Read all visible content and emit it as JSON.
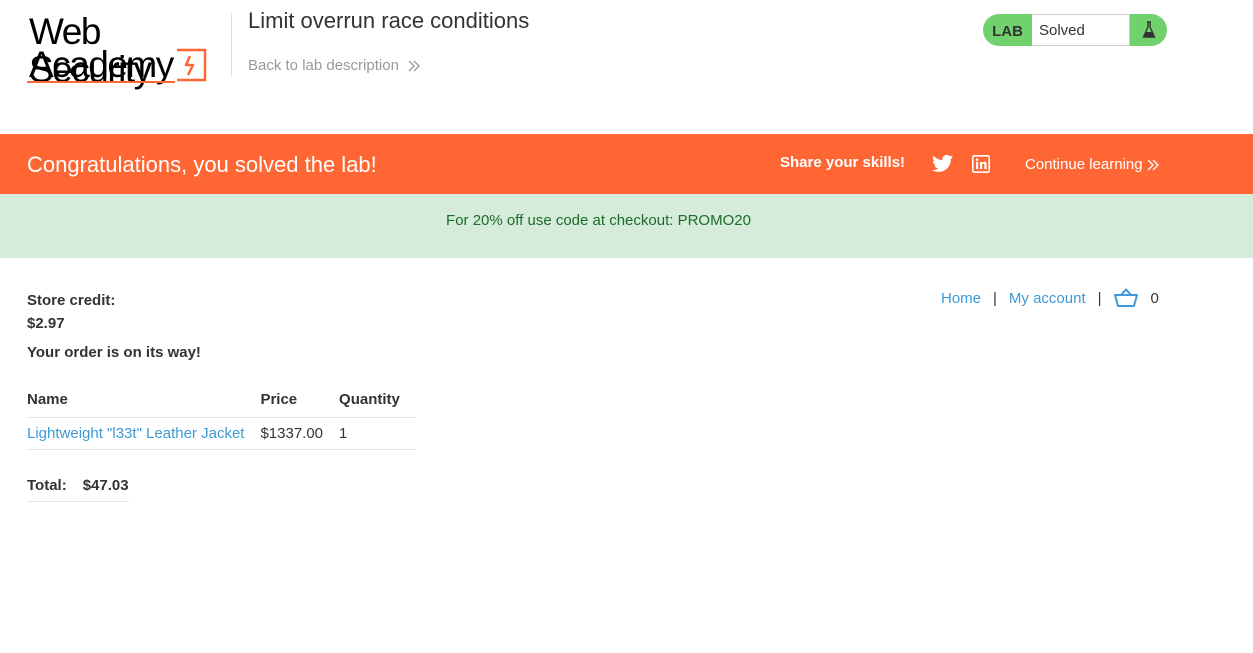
{
  "header": {
    "logo_line1": "Web Security",
    "logo_line2": "Academy",
    "lab_title": "Limit overrun race conditions",
    "back_link": "Back to lab description",
    "status_label": "LAB",
    "status_value": "Solved"
  },
  "banner": {
    "congrats": "Congratulations, you solved the lab!",
    "share": "Share your skills!",
    "continue": "Continue learning"
  },
  "promo": {
    "text": "For 20% off use code at checkout: PROMO20"
  },
  "account": {
    "store_credit_label": "Store credit:",
    "store_credit_value": "$2.97",
    "order_message": "Your order is on its way!"
  },
  "nav": {
    "home": "Home",
    "separator": "|",
    "my_account": "My account",
    "cart_count": "0"
  },
  "cart": {
    "headers": [
      "Name",
      "Price",
      "Quantity"
    ],
    "rows": [
      {
        "name": "Lightweight \"l33t\" Leather Jacket",
        "price": "$1337.00",
        "quantity": "1"
      }
    ],
    "total_label": "Total:",
    "total_value": "$47.03"
  },
  "colors": {
    "accent": "#ff6633",
    "link": "#3d9ad6",
    "solved": "#70d16d",
    "promo_bg": "#d4ecd9"
  }
}
